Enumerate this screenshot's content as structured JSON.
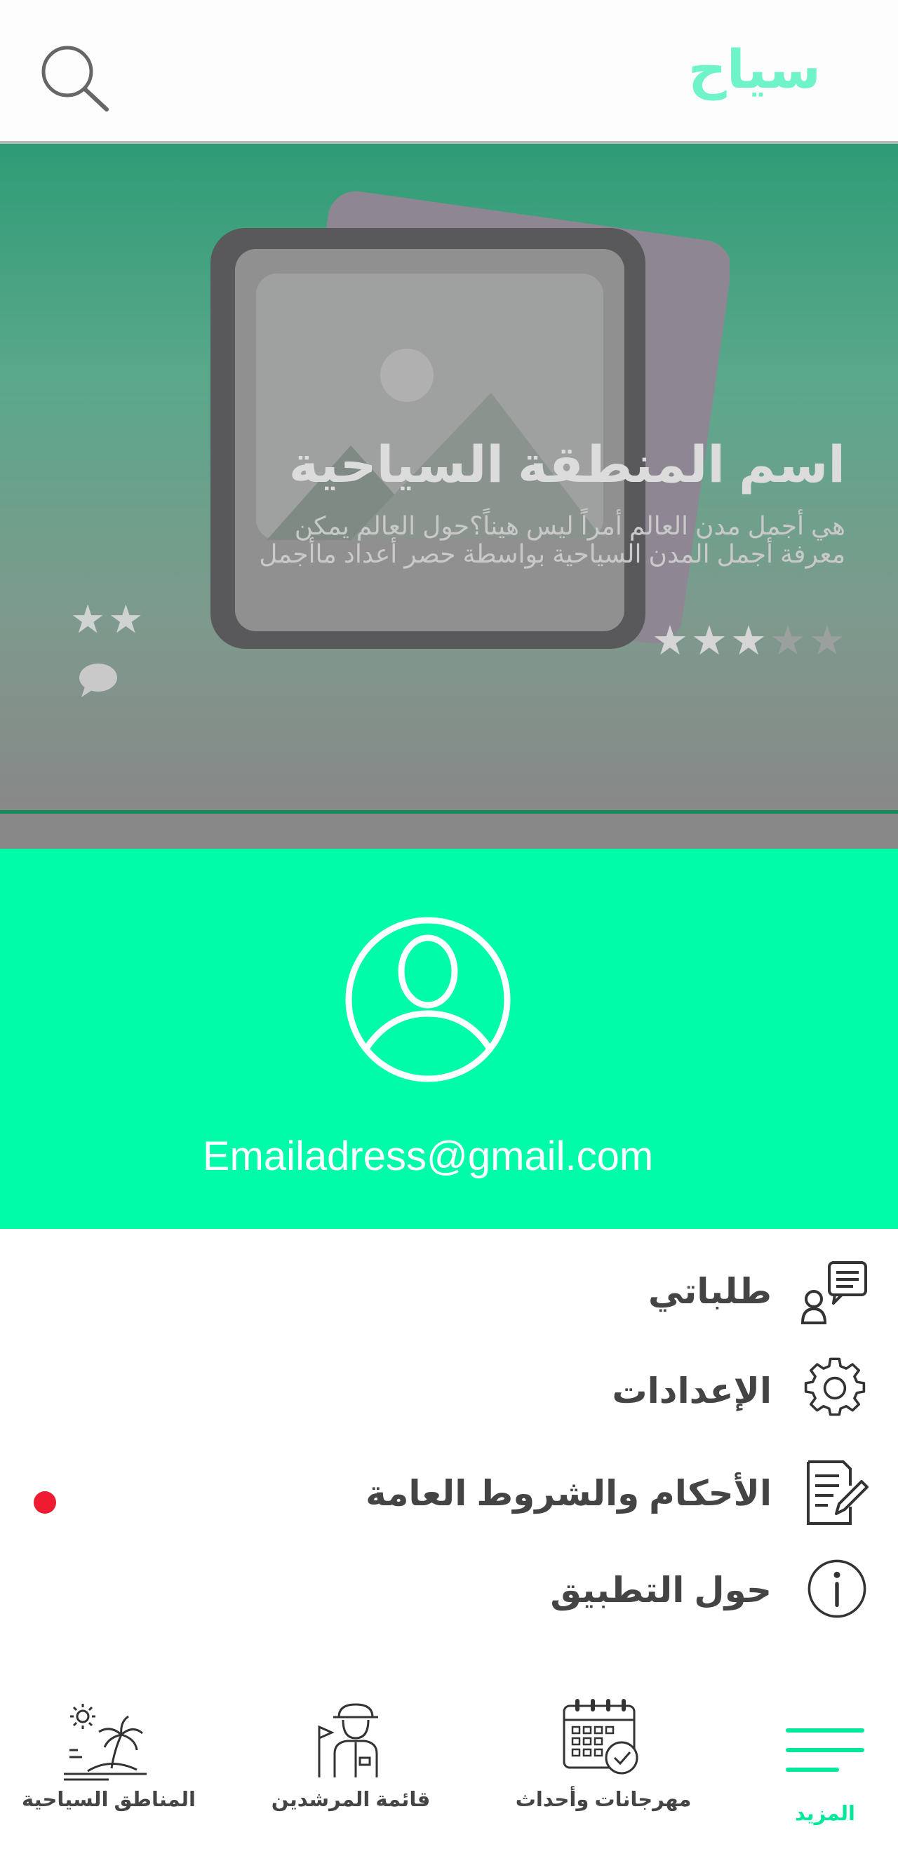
{
  "app": {
    "title": "سياح"
  },
  "icons": {
    "search": "search-icon",
    "image_placeholder": "image-placeholder-icon",
    "comment": "comment-icon",
    "user": "user-circle-icon",
    "requests": "requests-icon",
    "settings": "gear-icon",
    "terms": "document-edit-icon",
    "about": "info-icon",
    "tourist_areas": "island-icon",
    "guides": "guide-icon",
    "events": "calendar-icon",
    "more": "menu-icon"
  },
  "hero": {
    "title": "اسم المنطقة السياحية",
    "desc_line1": "هي أجمل مدن العالم أمراً ليس هيناً؟حول العالم  يمكن",
    "desc_line2": "معرفة أجمل المدن السياحية بواسطة حصر أعداد ماأجمل",
    "rating": 3,
    "rating_max": 5,
    "side_rating": 2,
    "dots_count": 8,
    "active_dot": 0
  },
  "profile": {
    "email": "Emailadress@gmail.com"
  },
  "menu": {
    "items": [
      {
        "label": "طلباتي"
      },
      {
        "label": "الإعدادات"
      },
      {
        "label": "الأحكام والشروط العامة"
      },
      {
        "label": "حول التطبيق"
      }
    ]
  },
  "nav": {
    "tourist_areas": "المناطق السياحية",
    "guides": "قائمة المرشدين",
    "events": "مهرجانات وأحداث",
    "more": "المزيد"
  },
  "colors": {
    "brand": "#00fca8",
    "title": "#6ff3c9",
    "active_nav": "#00e89a",
    "notification": "#ef1c31",
    "hero_line": "#138a5c"
  }
}
